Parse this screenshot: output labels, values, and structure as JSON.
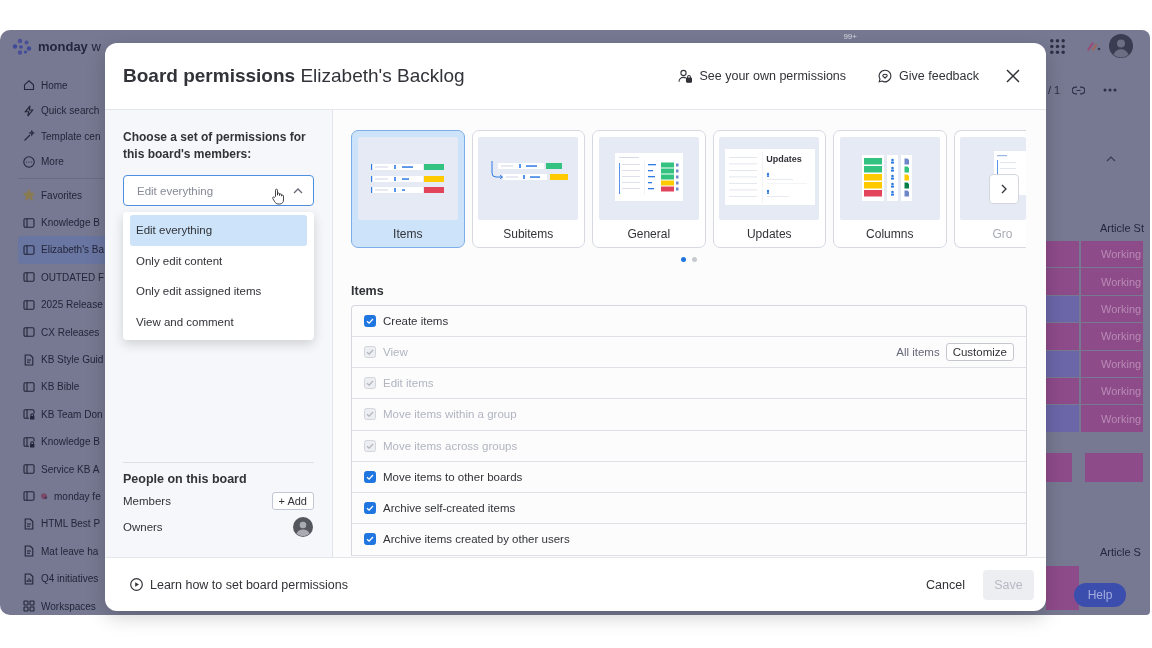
{
  "app": {
    "logo": "**monday** w",
    "notification_count": "99+",
    "sidebar": {
      "nav": [
        {
          "label": "Home",
          "kind": "home",
          "selected": false
        },
        {
          "label": "Quick search",
          "kind": "search",
          "selected": false
        },
        {
          "label": "Template cen",
          "kind": "templates",
          "selected": false
        },
        {
          "label": "More",
          "kind": "more",
          "selected": false
        }
      ],
      "items": [
        {
          "label": "Favorites",
          "kind": "favorites",
          "selected": false
        },
        {
          "label": "Knowledge B",
          "kind": "board",
          "selected": false
        },
        {
          "label": "Elizabeth's Ba",
          "kind": "board",
          "selected": true
        },
        {
          "label": "OUTDATED F",
          "kind": "board",
          "selected": false
        },
        {
          "label": "2025 Release",
          "kind": "board",
          "selected": false
        },
        {
          "label": "CX Releases",
          "kind": "board",
          "selected": false
        },
        {
          "label": "KB Style Guid",
          "kind": "doc",
          "selected": false
        },
        {
          "label": "KB Bible",
          "kind": "board",
          "selected": false
        },
        {
          "label": "KB Team Don",
          "kind": "locked",
          "selected": false
        },
        {
          "label": "Knowledge B",
          "kind": "locked",
          "selected": false
        },
        {
          "label": "Service KB A",
          "kind": "board",
          "selected": false
        },
        {
          "label": "monday fe",
          "kind": "emoji",
          "selected": false
        },
        {
          "label": "HTML Best P",
          "kind": "doc",
          "selected": false
        },
        {
          "label": "Mat leave ha",
          "kind": "doc",
          "selected": false
        },
        {
          "label": "Q4 initiatives",
          "kind": "dashboard",
          "selected": false
        },
        {
          "label": "Workspaces",
          "kind": "workspaces",
          "selected": false
        }
      ]
    },
    "board": {
      "page_indicator": "/ 1",
      "column_header": "Article St",
      "rows": [
        {
          "status": "Working",
          "color": "#8e4b8a"
        },
        {
          "status": "Working",
          "color": "#8e4b8a"
        },
        {
          "status": "Working",
          "color": "#6b66a8"
        },
        {
          "status": "Working",
          "color": "#8e4b8a"
        },
        {
          "status": "Working",
          "color": "#6b66a8"
        },
        {
          "status": "Working",
          "color": "#8e4b8a"
        },
        {
          "status": "Working",
          "color": "#6b66a8"
        }
      ],
      "second_column_header": "Article S",
      "help_button": "Help"
    }
  },
  "dialog": {
    "title": "**Board permissions** Elizabeth's Backlog",
    "header_actions": [
      {
        "label": "See your own permissions",
        "kind": "permissions"
      },
      {
        "label": "Give feedback",
        "kind": "feedback"
      }
    ],
    "prompt": "Choose a set of permissions for this board's members:",
    "permission_select": {
      "value": "Edit everything",
      "expanded": true,
      "options": [
        {
          "label": "Edit everything",
          "selected": true
        },
        {
          "label": "Only edit content",
          "selected": false
        },
        {
          "label": "Only edit assigned items",
          "selected": false
        },
        {
          "label": "View and comment",
          "selected": false
        }
      ]
    },
    "people": {
      "title": "People on this board",
      "members_label": "Members",
      "add_button": "+ Add",
      "owners_label": "Owners"
    },
    "categories": [
      {
        "label": "Items",
        "kind": "items",
        "selected": true,
        "partial": false
      },
      {
        "label": "Subitems",
        "kind": "subitems",
        "selected": false,
        "partial": false
      },
      {
        "label": "General",
        "kind": "general",
        "selected": false,
        "partial": false
      },
      {
        "label": "Updates",
        "kind": "updates",
        "selected": false,
        "partial": false,
        "image_heading": "Updates"
      },
      {
        "label": "Columns",
        "kind": "columns",
        "selected": false,
        "partial": false
      },
      {
        "label": "Gro",
        "kind": "groups",
        "selected": false,
        "partial": true
      }
    ],
    "carousel_pages": [
      {
        "selected": true
      },
      {
        "selected": false
      }
    ],
    "section": {
      "title": "Items",
      "permissions": [
        {
          "label": "Create items",
          "checked": true,
          "disabled": false
        },
        {
          "label": "View",
          "checked": true,
          "disabled": true,
          "scope": "All items",
          "action": "Customize"
        },
        {
          "label": "Edit items",
          "checked": true,
          "disabled": true
        },
        {
          "label": "Move items within a group",
          "checked": true,
          "disabled": true
        },
        {
          "label": "Move items across groups",
          "checked": true,
          "disabled": true
        },
        {
          "label": "Move items to other boards",
          "checked": true,
          "disabled": false
        },
        {
          "label": "Archive self-created items",
          "checked": true,
          "disabled": false
        },
        {
          "label": "Archive items created by other users",
          "checked": true,
          "disabled": false
        }
      ]
    },
    "footer": {
      "learn_link": "Learn how to set board permissions",
      "cancel": "Cancel",
      "save": {
        "label": "Save",
        "disabled": true
      }
    }
  }
}
